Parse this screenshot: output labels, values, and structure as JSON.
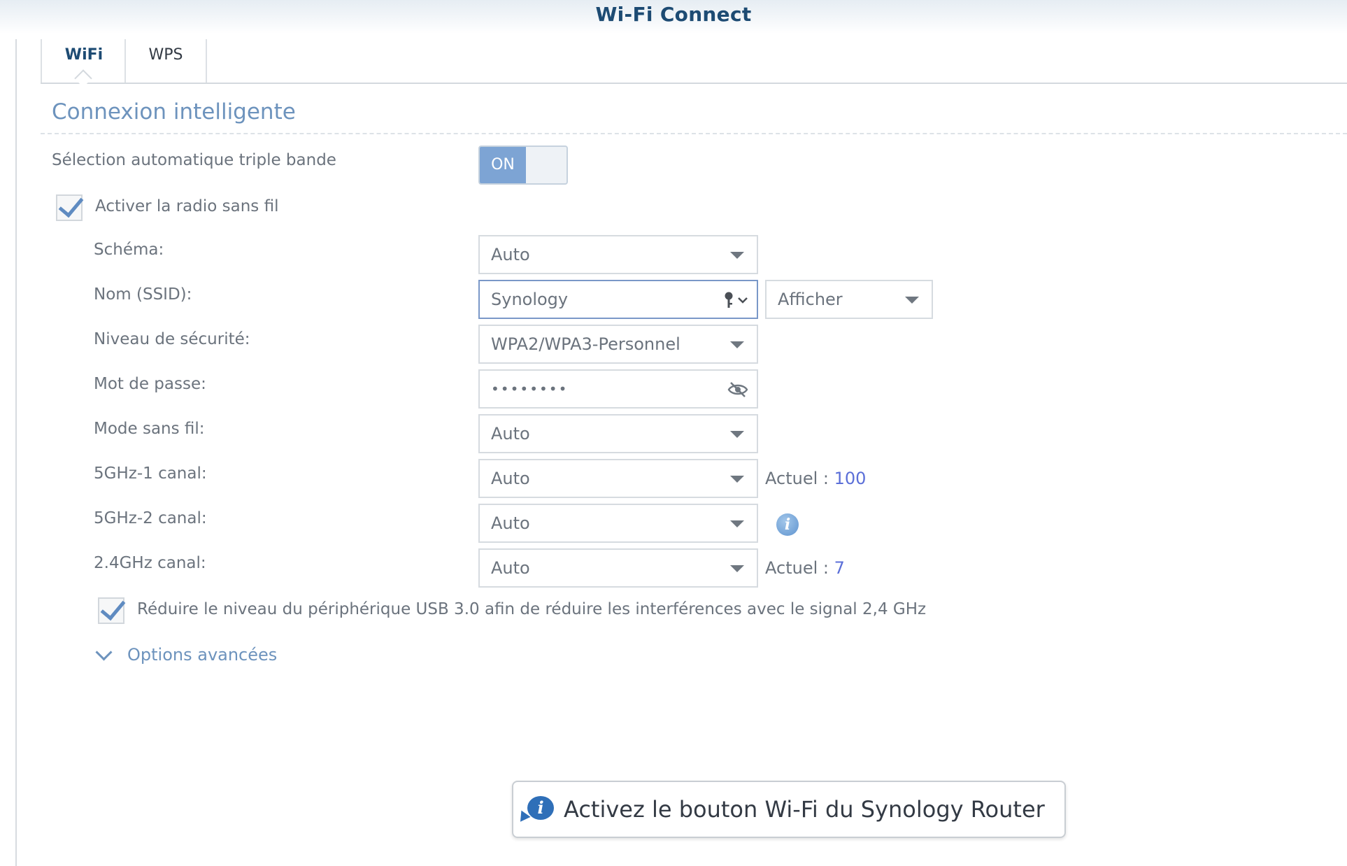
{
  "window": {
    "title": "Wi-Fi Connect"
  },
  "tabs": [
    {
      "label": "WiFi",
      "active": true
    },
    {
      "label": "WPS",
      "active": false
    }
  ],
  "section": {
    "title": "Connexion intelligente"
  },
  "triple_band": {
    "label": "Sélection automatique triple bande",
    "toggle_label": "ON",
    "enabled": true
  },
  "radio": {
    "label": "Activer la radio sans fil",
    "checked": true
  },
  "fields": {
    "schema": {
      "label": "Schéma:",
      "value": "Auto"
    },
    "ssid": {
      "label": "Nom (SSID):",
      "value": "Synology",
      "visibility_value": "Afficher"
    },
    "security": {
      "label": "Niveau de sécurité:",
      "value": "WPA2/WPA3-Personnel"
    },
    "password": {
      "label": "Mot de passe:",
      "value": "••••••••"
    },
    "wireless_mode": {
      "label": "Mode sans fil:",
      "value": "Auto"
    },
    "ch_5g1": {
      "label": "5GHz-1 canal:",
      "value": "Auto",
      "current_label": "Actuel :",
      "current_value": "100"
    },
    "ch_5g2": {
      "label": "5GHz-2 canal:",
      "value": "Auto"
    },
    "ch_24g": {
      "label": "2.4GHz canal:",
      "value": "Auto",
      "current_label": "Actuel :",
      "current_value": "7"
    }
  },
  "usb": {
    "label": "Réduire le niveau du périphérique USB 3.0 afin de réduire les interférences avec le signal 2,4 GHz",
    "checked": true
  },
  "advanced": {
    "label": "Options avancées"
  },
  "tooltip": {
    "text": "Activez le bouton Wi-Fi du Synology Router"
  },
  "colors": {
    "accent": "#6d93bd",
    "toggle_on": "#7da4d4",
    "title": "#1d4b73",
    "link_number": "#5b6fd8"
  },
  "icons": {
    "ssid_key": "key-icon",
    "password": "eye-slash-icon",
    "info": "info-icon",
    "expand": "chevron-down-icon"
  }
}
